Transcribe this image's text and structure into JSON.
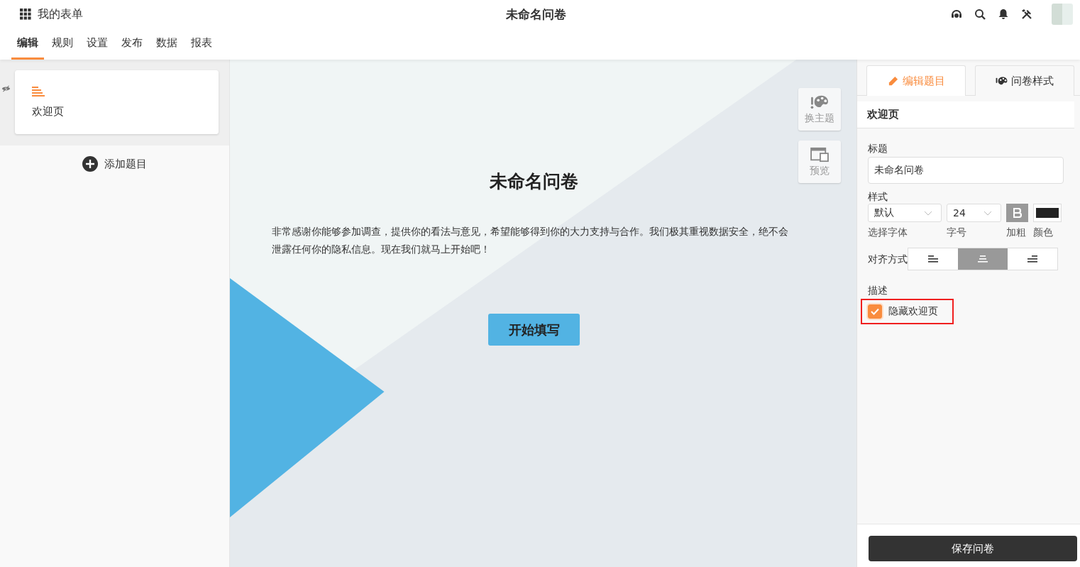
{
  "app": {
    "title": "我的表单"
  },
  "page_title": "未命名问卷",
  "tabs": [
    {
      "label": "编辑",
      "selected": true
    },
    {
      "label": "规则",
      "selected": false
    },
    {
      "label": "设置",
      "selected": false
    },
    {
      "label": "发布",
      "selected": false
    },
    {
      "label": "数据",
      "selected": false
    },
    {
      "label": "报表",
      "selected": false
    }
  ],
  "sidebar": {
    "items": [
      {
        "label": "欢迎页",
        "selected": true
      }
    ],
    "add_button": "添加题目"
  },
  "canvas": {
    "title": "未命名问卷",
    "description": "非常感谢你能够参加调查，提供你的看法与意见，希望能够得到你的大力支持与合作。我们极其重视数据安全，绝不会泄露任何你的隐私信息。现在我们就马上开始吧！",
    "start_button": "开始填写",
    "tools": [
      {
        "kind": "theme",
        "label": "换主题"
      },
      {
        "kind": "preview",
        "label": "预览"
      }
    ]
  },
  "panel": {
    "tabs": [
      {
        "kind": "edit",
        "label": "编辑题目",
        "selected": true
      },
      {
        "kind": "style",
        "label": "问卷样式",
        "selected": false
      }
    ],
    "section_title": "欢迎页",
    "title_label": "标题",
    "title_value": "未命名问卷",
    "style_label": "样式",
    "font": "默认",
    "font_caption": "选择字体",
    "size": "24",
    "size_caption": "字号",
    "bold": true,
    "bold_caption": "加粗",
    "color": "#222222",
    "color_caption": "颜色",
    "align_label": "对齐方式",
    "align_options": [
      {
        "kind": "left",
        "selected": false
      },
      {
        "kind": "center",
        "selected": true
      },
      {
        "kind": "right",
        "selected": false
      }
    ],
    "desc_label": "描述",
    "hide_welcome": {
      "label": "隐藏欢迎页",
      "checked": true,
      "highlighted": true
    },
    "save_button": "保存问卷"
  }
}
